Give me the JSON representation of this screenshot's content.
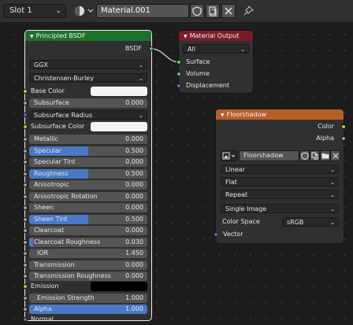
{
  "header": {
    "slot_label": "Slot 1",
    "material_name": "Material.001"
  },
  "colors": {
    "shader_header": "#1d7229",
    "output_header": "#7a1c26",
    "texture_header": "#b85f28",
    "field": "#545454",
    "fill_accent": "#4a78c4",
    "socket_color": "#c7c729",
    "socket_float": "#a1a1a1",
    "socket_vector": "#6363c7",
    "socket_shader": "#63c763"
  },
  "bsdf": {
    "title": "Principled BSDF",
    "output_label": "BSDF",
    "distribution": "GGX",
    "subsurface_method": "Christensen-Burley",
    "base_color_label": "Base Color",
    "subsurface_label": "Subsurface",
    "subsurface_value": "0.000",
    "subsurface_radius_label": "Subsurface Radius",
    "subsurface_color_label": "Subsurface Color",
    "params": [
      {
        "label": "Metallic",
        "value": "0.000",
        "fill": 0
      },
      {
        "label": "Specular",
        "value": "0.500",
        "fill": 0.5
      },
      {
        "label": "Specular Tint",
        "value": "0.000",
        "fill": 0
      },
      {
        "label": "Roughness",
        "value": "0.500",
        "fill": 0.5
      },
      {
        "label": "Anisotropic",
        "value": "0.000",
        "fill": 0
      },
      {
        "label": "Anisotropic Rotation",
        "value": "0.000",
        "fill": 0
      },
      {
        "label": "Sheen",
        "value": "0.000",
        "fill": 0
      },
      {
        "label": "Sheen Tint",
        "value": "0.500",
        "fill": 0.5
      },
      {
        "label": "Clearcoat",
        "value": "0.000",
        "fill": 0
      },
      {
        "label": "Clearcoat Roughness",
        "value": "0.030",
        "fill": 0.03
      },
      {
        "label": "IOR",
        "value": "1.450",
        "fill": 0
      },
      {
        "label": "Transmission",
        "value": "0.000",
        "fill": 0
      },
      {
        "label": "Transmission Roughness",
        "value": "0.000",
        "fill": 0
      }
    ],
    "emission_label": "Emission",
    "emission_strength_label": "Emission Strength",
    "emission_strength_value": "1.000",
    "alpha_label": "Alpha",
    "alpha_value": "1.000",
    "normal_label": "Normal"
  },
  "output": {
    "title": "Material Output",
    "target": "All",
    "inputs": [
      "Surface",
      "Volume",
      "Displacement"
    ]
  },
  "texture": {
    "title": "Floorshadow",
    "outputs": [
      "Color",
      "Alpha"
    ],
    "image_name": "Floorshadow",
    "interpolation": "Linear",
    "projection": "Flat",
    "extension": "Repeat",
    "source": "Single Image",
    "color_space_label": "Color Space",
    "color_space": "sRGB",
    "vector_label": "Vector"
  }
}
